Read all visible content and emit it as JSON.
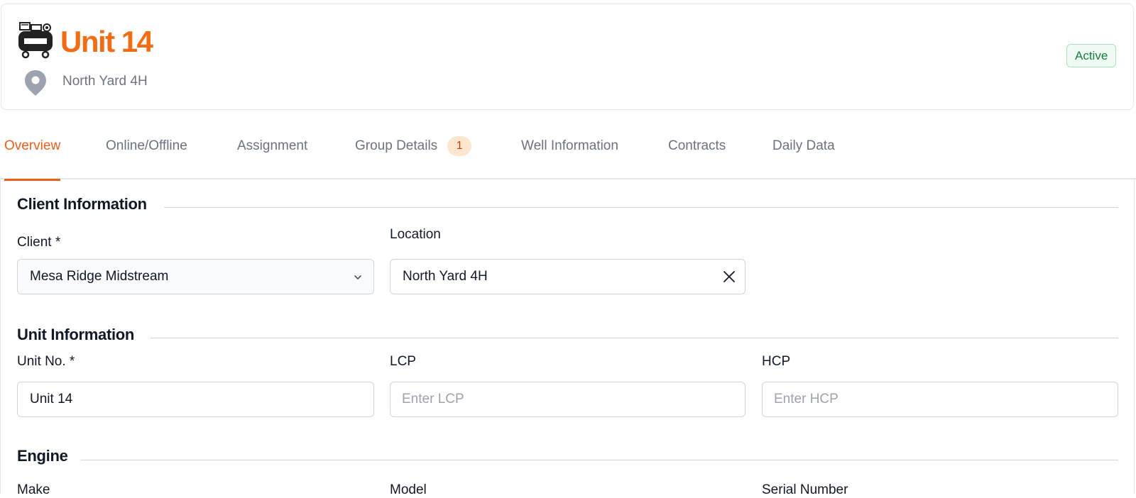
{
  "header": {
    "title": "Unit 14",
    "location": "North Yard 4H",
    "status": "Active",
    "unit_icon": "compressor-icon",
    "location_icon": "map-pin-icon"
  },
  "colors": {
    "accent": "#e8601a",
    "title": "#f26c15",
    "status_text": "#15803d",
    "status_bg": "#effbf3"
  },
  "tabs": [
    {
      "label": "Overview",
      "active": true
    },
    {
      "label": "Online/Offline"
    },
    {
      "label": "Assignment"
    },
    {
      "label": "Group Details",
      "badge": "1"
    },
    {
      "label": "Well Information"
    },
    {
      "label": "Contracts"
    },
    {
      "label": "Daily Data"
    }
  ],
  "client_info": {
    "title": "Client Information",
    "client_label": "Client *",
    "client_value": "Mesa Ridge Midstream",
    "location_label": "Location",
    "location_value": "North Yard 4H"
  },
  "unit_info": {
    "title": "Unit Information",
    "unit_no_label": "Unit No. *",
    "unit_no_value": "Unit 14",
    "lcp_label": "LCP",
    "lcp_placeholder": "Enter LCP",
    "hcp_label": "HCP",
    "hcp_placeholder": "Enter HCP"
  },
  "engine": {
    "title": "Engine",
    "make_label": "Make",
    "model_label": "Model",
    "serial_label": "Serial Number"
  }
}
